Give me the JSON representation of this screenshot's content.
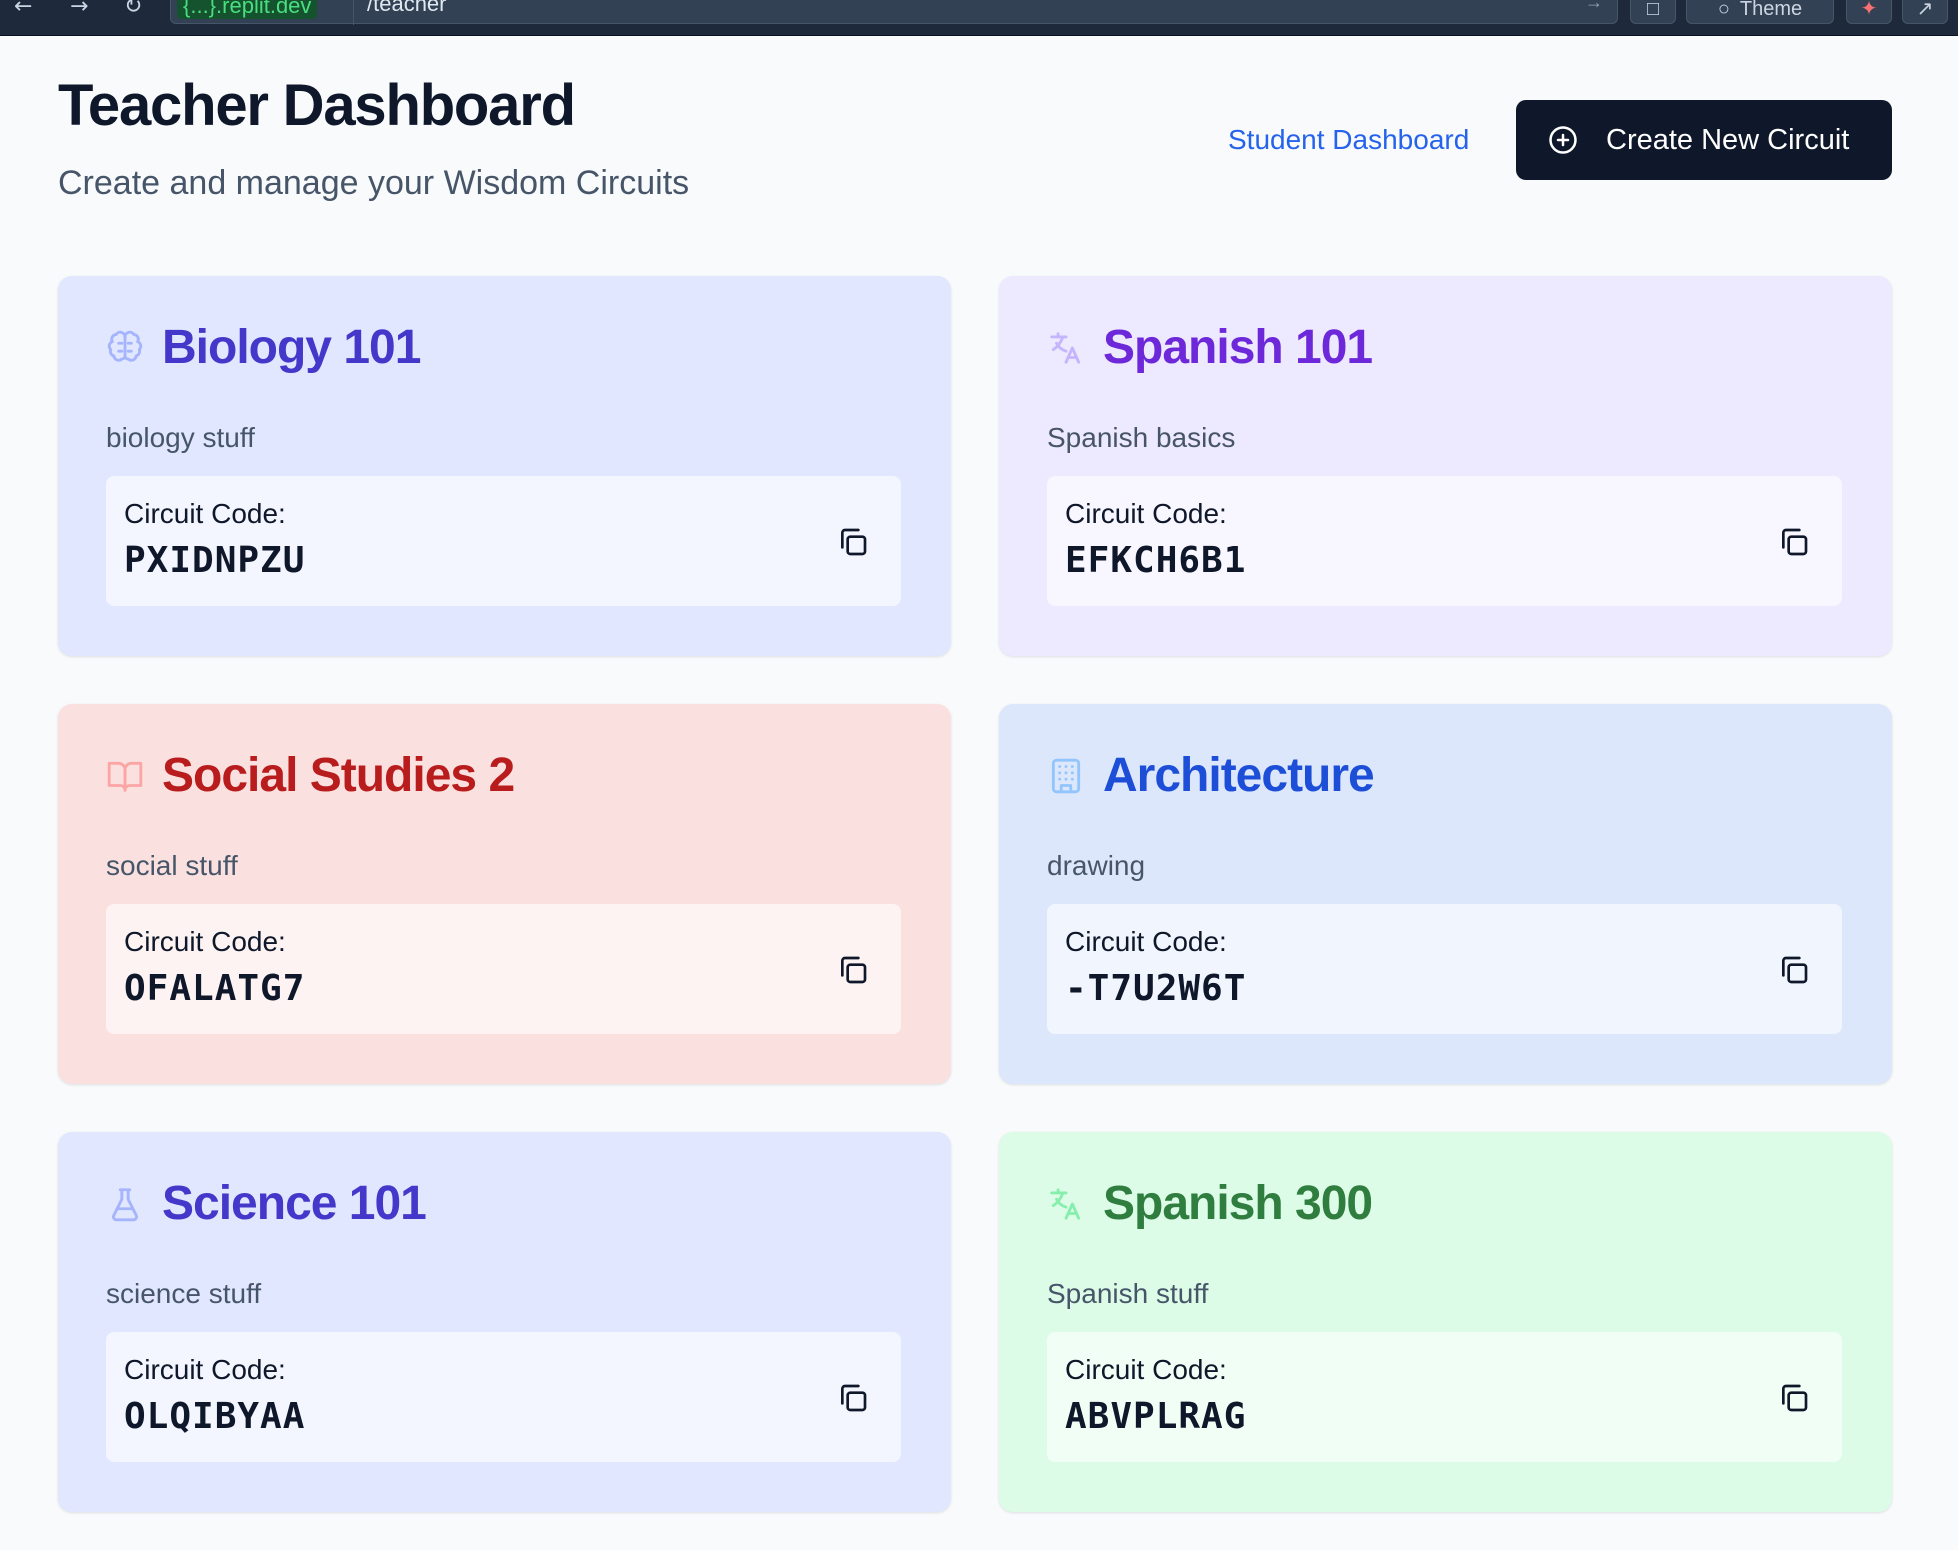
{
  "browser": {
    "url_host": "{...}.replit.dev",
    "url_path": "/teacher",
    "theme_label": "Theme"
  },
  "header": {
    "title": "Teacher Dashboard",
    "subtitle": "Create and manage your Wisdom Circuits",
    "student_link": "Student Dashboard",
    "create_button": "Create New Circuit"
  },
  "code_label": "Circuit Code:",
  "circuits": [
    {
      "title": "Biology 101",
      "description": "biology stuff",
      "code": "PXIDNPZU",
      "icon": "brain-icon",
      "colors": {
        "bg": "#e0e7ff",
        "title": "#4338ca",
        "icon": "#a5b4fc"
      }
    },
    {
      "title": "Spanish 101",
      "description": "Spanish basics",
      "code": "EFKCH6B1",
      "icon": "language-icon",
      "colors": {
        "bg": "#ede9fe",
        "title": "#6d28d9",
        "icon": "#c4b5fd"
      }
    },
    {
      "title": "Social Studies 2",
      "description": "social stuff",
      "code": "OFALATG7",
      "icon": "book-open-icon",
      "colors": {
        "bg": "#fae1df",
        "title": "#b91c1c",
        "icon": "#fca5a5"
      }
    },
    {
      "title": "Architecture",
      "description": "drawing",
      "code": "-T7U2W6T",
      "icon": "building-icon",
      "colors": {
        "bg": "#dde7fb",
        "title": "#1d4ed8",
        "icon": "#93c5fd"
      }
    },
    {
      "title": "Science 101",
      "description": "science stuff",
      "code": "OLQIBYAA",
      "icon": "flask-icon",
      "colors": {
        "bg": "#e0e7ff",
        "title": "#4338ca",
        "icon": "#a5b4fc"
      }
    },
    {
      "title": "Spanish 300",
      "description": "Spanish stuff",
      "code": "ABVPLRAG",
      "icon": "language-icon",
      "colors": {
        "bg": "#dcfce7",
        "title": "#2f7d3f",
        "icon": "#86efac"
      }
    }
  ]
}
